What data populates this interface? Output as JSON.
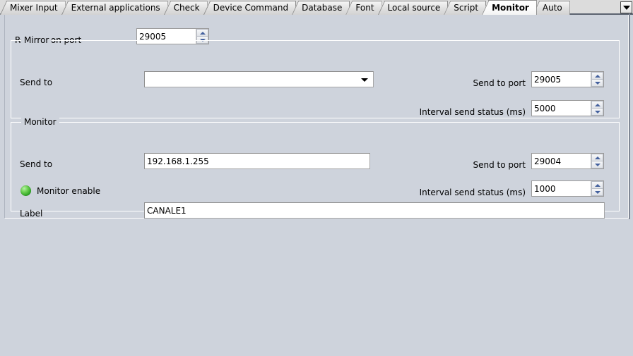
{
  "tabs": [
    {
      "label": "Mixer Input",
      "active": false
    },
    {
      "label": "External applications",
      "active": false
    },
    {
      "label": "Check",
      "active": false
    },
    {
      "label": "Device Command",
      "active": false
    },
    {
      "label": "Database",
      "active": false
    },
    {
      "label": "Font",
      "active": false
    },
    {
      "label": "Local source",
      "active": false
    },
    {
      "label": "Script",
      "active": false
    },
    {
      "label": "Monitor",
      "active": true
    },
    {
      "label": "Auto",
      "active": false
    }
  ],
  "tab_overflow_icon": "chevron-down-icon",
  "top": {
    "receive_on_port_label": "Receive on port",
    "receive_on_port_value": "29005"
  },
  "mirror": {
    "title": "Mirror",
    "send_to_label": "Send to",
    "send_to_value": "",
    "send_to_port_label": "Send to port",
    "send_to_port_value": "29005",
    "interval_label": "Interval send status (ms)",
    "interval_value": "5000"
  },
  "monitor": {
    "title": "Monitor",
    "send_to_label": "Send to",
    "send_to_value": "192.168.1.255",
    "send_to_port_label": "Send to port",
    "send_to_port_value": "29004",
    "interval_label": "Interval send status (ms)",
    "interval_value": "1000",
    "enable_label": "Monitor enable",
    "enable_led_icon": "green-led-icon",
    "enable_state": "on",
    "label_label": "Label",
    "label_value": "CANALE1"
  },
  "colors": {
    "background": "#ced3dc",
    "field_background": "#ffffff",
    "led_green": "#3fb230",
    "spinner_arrow": "#44619e",
    "tab_underline": "#5b6270"
  }
}
